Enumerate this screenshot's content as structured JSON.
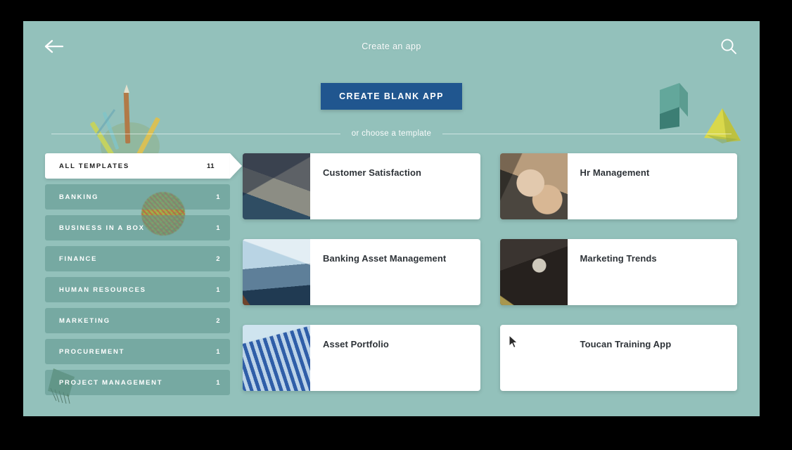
{
  "header": {
    "title": "Create an app",
    "back_icon": "arrow-left-icon",
    "search_icon": "search-icon"
  },
  "cta": {
    "create_blank_app_label": "CREATE BLANK APP"
  },
  "divider": {
    "label": "or choose a template"
  },
  "sidebar": {
    "items": [
      {
        "label": "ALL TEMPLATES",
        "count": "11",
        "active": true
      },
      {
        "label": "BANKING",
        "count": "1",
        "active": false
      },
      {
        "label": "BUSINESS IN A BOX",
        "count": "1",
        "active": false
      },
      {
        "label": "FINANCE",
        "count": "2",
        "active": false
      },
      {
        "label": "HUMAN RESOURCES",
        "count": "1",
        "active": false
      },
      {
        "label": "MARKETING",
        "count": "2",
        "active": false
      },
      {
        "label": "PROCUREMENT",
        "count": "1",
        "active": false
      },
      {
        "label": "PROJECT MANAGEMENT",
        "count": "1",
        "active": false
      }
    ]
  },
  "templates": {
    "cards": [
      {
        "title": "Customer Satisfaction",
        "thumb": "thumb-customer"
      },
      {
        "title": "Hr Management",
        "thumb": "thumb-hr"
      },
      {
        "title": "Banking Asset Management",
        "thumb": "thumb-banking"
      },
      {
        "title": "Marketing Trends",
        "thumb": "thumb-marketing"
      },
      {
        "title": "Asset Portfolio",
        "thumb": "thumb-asset"
      },
      {
        "title": "Toucan Training App",
        "thumb": "blank"
      }
    ]
  },
  "colors": {
    "background": "#93c1bb",
    "cta_blue": "#20568f",
    "card_white": "#ffffff",
    "sidebar_item": "#5e968e",
    "text_light": "#ffffff",
    "text_dark": "#2e3338"
  },
  "decorations": [
    {
      "name": "pencils-illustration"
    },
    {
      "name": "yarn-ball-illustration"
    },
    {
      "name": "prism-illustration"
    },
    {
      "name": "pyramid-illustration"
    },
    {
      "name": "brush-illustration"
    }
  ]
}
